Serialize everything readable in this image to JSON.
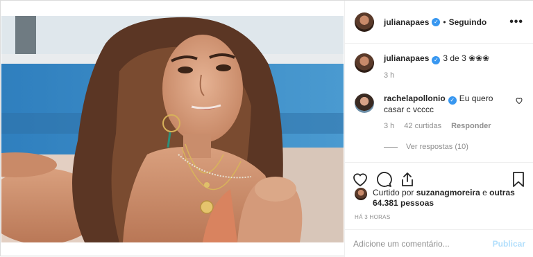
{
  "header": {
    "username": "julianapaes",
    "separator": "•",
    "follow_status": "Seguindo",
    "more_label": "•••"
  },
  "caption": {
    "username": "julianapaes",
    "text": "3 de 3 ❀❀❀",
    "time": "3 h"
  },
  "comment": {
    "username": "rachelapollonio",
    "text": "Eu quero casar c vcccc",
    "time": "3 h",
    "likes": "42 curtidas",
    "reply_label": "Responder",
    "view_replies": "Ver respostas (10)"
  },
  "likes": {
    "prefix": "Curtido por",
    "user": "suzanagmoreira",
    "conj": "e",
    "others": "outras 64.381 pessoas"
  },
  "timestamp": "HÁ 3 HORAS",
  "add_comment": {
    "placeholder": "Adicione um comentário...",
    "publish_label": "Publicar"
  },
  "icons": {
    "verified": "verified-badge-icon",
    "heart": "heart-icon",
    "comment": "comment-icon",
    "share": "share-icon",
    "save": "bookmark-icon",
    "more": "more-options-icon"
  },
  "colors": {
    "verified_blue": "#3897f0",
    "publish_disabled": "#b2dffc",
    "muted_text": "#8e8e8e"
  }
}
